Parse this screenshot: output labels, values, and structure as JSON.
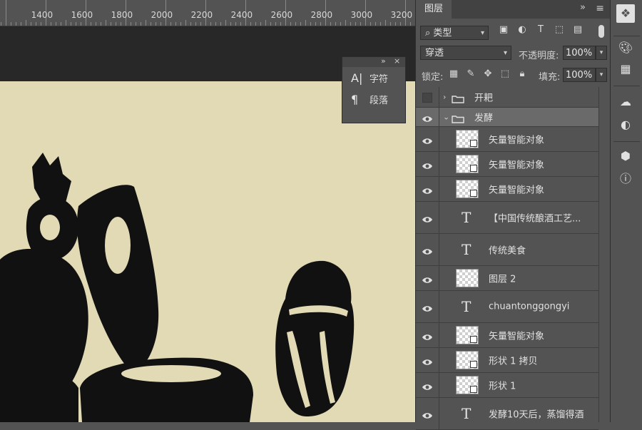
{
  "ruler": {
    "labels": [
      "1400",
      "1600",
      "1800",
      "2000",
      "2200",
      "2400",
      "2600",
      "2800",
      "3000",
      "3200"
    ]
  },
  "float_panel": {
    "expand": "»",
    "close": "×",
    "items": [
      {
        "icon": "A|",
        "label": "字符"
      },
      {
        "icon": "¶",
        "label": "段落"
      }
    ]
  },
  "layers_panel": {
    "tab_label": "图层",
    "more": "»",
    "menu": "≡",
    "filter": {
      "value": "类型",
      "search_icon": "⌕"
    },
    "blend": {
      "value": "穿透"
    },
    "opacity": {
      "label": "不透明度:",
      "value": "100%"
    },
    "lock": {
      "label": "锁定:"
    },
    "fill": {
      "label": "填充:",
      "value": "100%"
    },
    "layers": [
      {
        "name": "开耙",
        "kind": "group-closed",
        "visible": false
      },
      {
        "name": "发酵",
        "kind": "group-open",
        "visible": true
      },
      {
        "name": "矢量智能对象",
        "kind": "smart",
        "visible": true
      },
      {
        "name": "矢量智能对象",
        "kind": "smart",
        "visible": true
      },
      {
        "name": "矢量智能对象",
        "kind": "smart",
        "visible": true
      },
      {
        "name": "【中国传统酿酒工艺...",
        "kind": "text",
        "visible": true
      },
      {
        "name": "传统美食",
        "kind": "text",
        "visible": true
      },
      {
        "name": "图层 2",
        "kind": "raster",
        "visible": true
      },
      {
        "name": "chuantonggongyi",
        "kind": "text",
        "visible": true
      },
      {
        "name": "矢量智能对象",
        "kind": "smart",
        "visible": true
      },
      {
        "name": "形状 1 拷贝",
        "kind": "shape",
        "visible": true
      },
      {
        "name": "形状 1",
        "kind": "shape",
        "visible": true
      },
      {
        "name": "发酵10天后，蒸馏得酒",
        "kind": "text",
        "visible": true
      }
    ]
  },
  "colors": {
    "artboard": "#e2d9b5",
    "ink": "#111111",
    "panel": "#535353",
    "selected_row": "#6a6a6a"
  }
}
